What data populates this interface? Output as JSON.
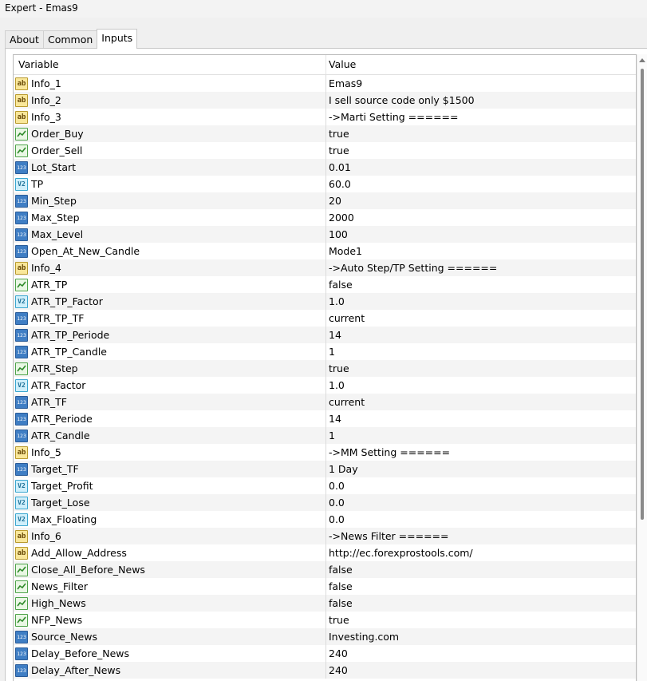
{
  "window": {
    "title": "Expert - Emas9"
  },
  "tabs": [
    {
      "label": "About",
      "active": false
    },
    {
      "label": "Common",
      "active": false
    },
    {
      "label": "Inputs",
      "active": true
    }
  ],
  "table": {
    "headers": {
      "variable": "Variable",
      "value": "Value"
    },
    "rows": [
      {
        "type": "string",
        "name": "Info_1",
        "value": "Emas9"
      },
      {
        "type": "string",
        "name": "Info_2",
        "value": "I sell source code only $1500"
      },
      {
        "type": "string",
        "name": "Info_3",
        "value": "->Marti Setting ======"
      },
      {
        "type": "bool",
        "name": "Order_Buy",
        "value": "true"
      },
      {
        "type": "bool",
        "name": "Order_Sell",
        "value": "true"
      },
      {
        "type": "int",
        "name": "Lot_Start",
        "value": "0.01"
      },
      {
        "type": "double",
        "name": "TP",
        "value": "60.0"
      },
      {
        "type": "int",
        "name": "Min_Step",
        "value": "20"
      },
      {
        "type": "int",
        "name": "Max_Step",
        "value": "2000"
      },
      {
        "type": "int",
        "name": "Max_Level",
        "value": "100"
      },
      {
        "type": "enum",
        "name": "Open_At_New_Candle",
        "value": "Mode1"
      },
      {
        "type": "string",
        "name": "Info_4",
        "value": "->Auto Step/TP Setting ======"
      },
      {
        "type": "bool",
        "name": "ATR_TP",
        "value": "false"
      },
      {
        "type": "double",
        "name": "ATR_TP_Factor",
        "value": "1.0"
      },
      {
        "type": "enum",
        "name": "ATR_TP_TF",
        "value": "current"
      },
      {
        "type": "int",
        "name": "ATR_TP_Periode",
        "value": "14"
      },
      {
        "type": "int",
        "name": "ATR_TP_Candle",
        "value": "1"
      },
      {
        "type": "bool",
        "name": "ATR_Step",
        "value": "true"
      },
      {
        "type": "double",
        "name": "ATR_Factor",
        "value": "1.0"
      },
      {
        "type": "enum",
        "name": "ATR_TF",
        "value": "current"
      },
      {
        "type": "int",
        "name": "ATR_Periode",
        "value": "14"
      },
      {
        "type": "int",
        "name": "ATR_Candle",
        "value": "1"
      },
      {
        "type": "string",
        "name": "Info_5",
        "value": "->MM Setting ======"
      },
      {
        "type": "enum",
        "name": "Target_TF",
        "value": "1 Day"
      },
      {
        "type": "double",
        "name": "Target_Profit",
        "value": "0.0"
      },
      {
        "type": "double",
        "name": "Target_Lose",
        "value": "0.0"
      },
      {
        "type": "double",
        "name": "Max_Floating",
        "value": "0.0"
      },
      {
        "type": "string",
        "name": "Info_6",
        "value": "->News Filter ======"
      },
      {
        "type": "string",
        "name": "Add_Allow_Address",
        "value": "http://ec.forexprostools.com/"
      },
      {
        "type": "bool",
        "name": "Close_All_Before_News",
        "value": "false"
      },
      {
        "type": "bool",
        "name": "News_Filter",
        "value": "false"
      },
      {
        "type": "bool",
        "name": "High_News",
        "value": "false"
      },
      {
        "type": "bool",
        "name": "NFP_News",
        "value": "true"
      },
      {
        "type": "enum",
        "name": "Source_News",
        "value": "Investing.com"
      },
      {
        "type": "int",
        "name": "Delay_Before_News",
        "value": "240"
      },
      {
        "type": "int",
        "name": "Delay_After_News",
        "value": "240"
      }
    ]
  },
  "icons": {
    "string": {
      "name": "string-type-icon",
      "glyph": "ab"
    },
    "bool": {
      "name": "bool-type-icon",
      "glyph": ""
    },
    "int": {
      "name": "integer-type-icon",
      "glyph": "123"
    },
    "double": {
      "name": "double-type-icon",
      "glyph": "V2"
    },
    "enum": {
      "name": "enum-type-icon",
      "glyph": "123"
    }
  }
}
